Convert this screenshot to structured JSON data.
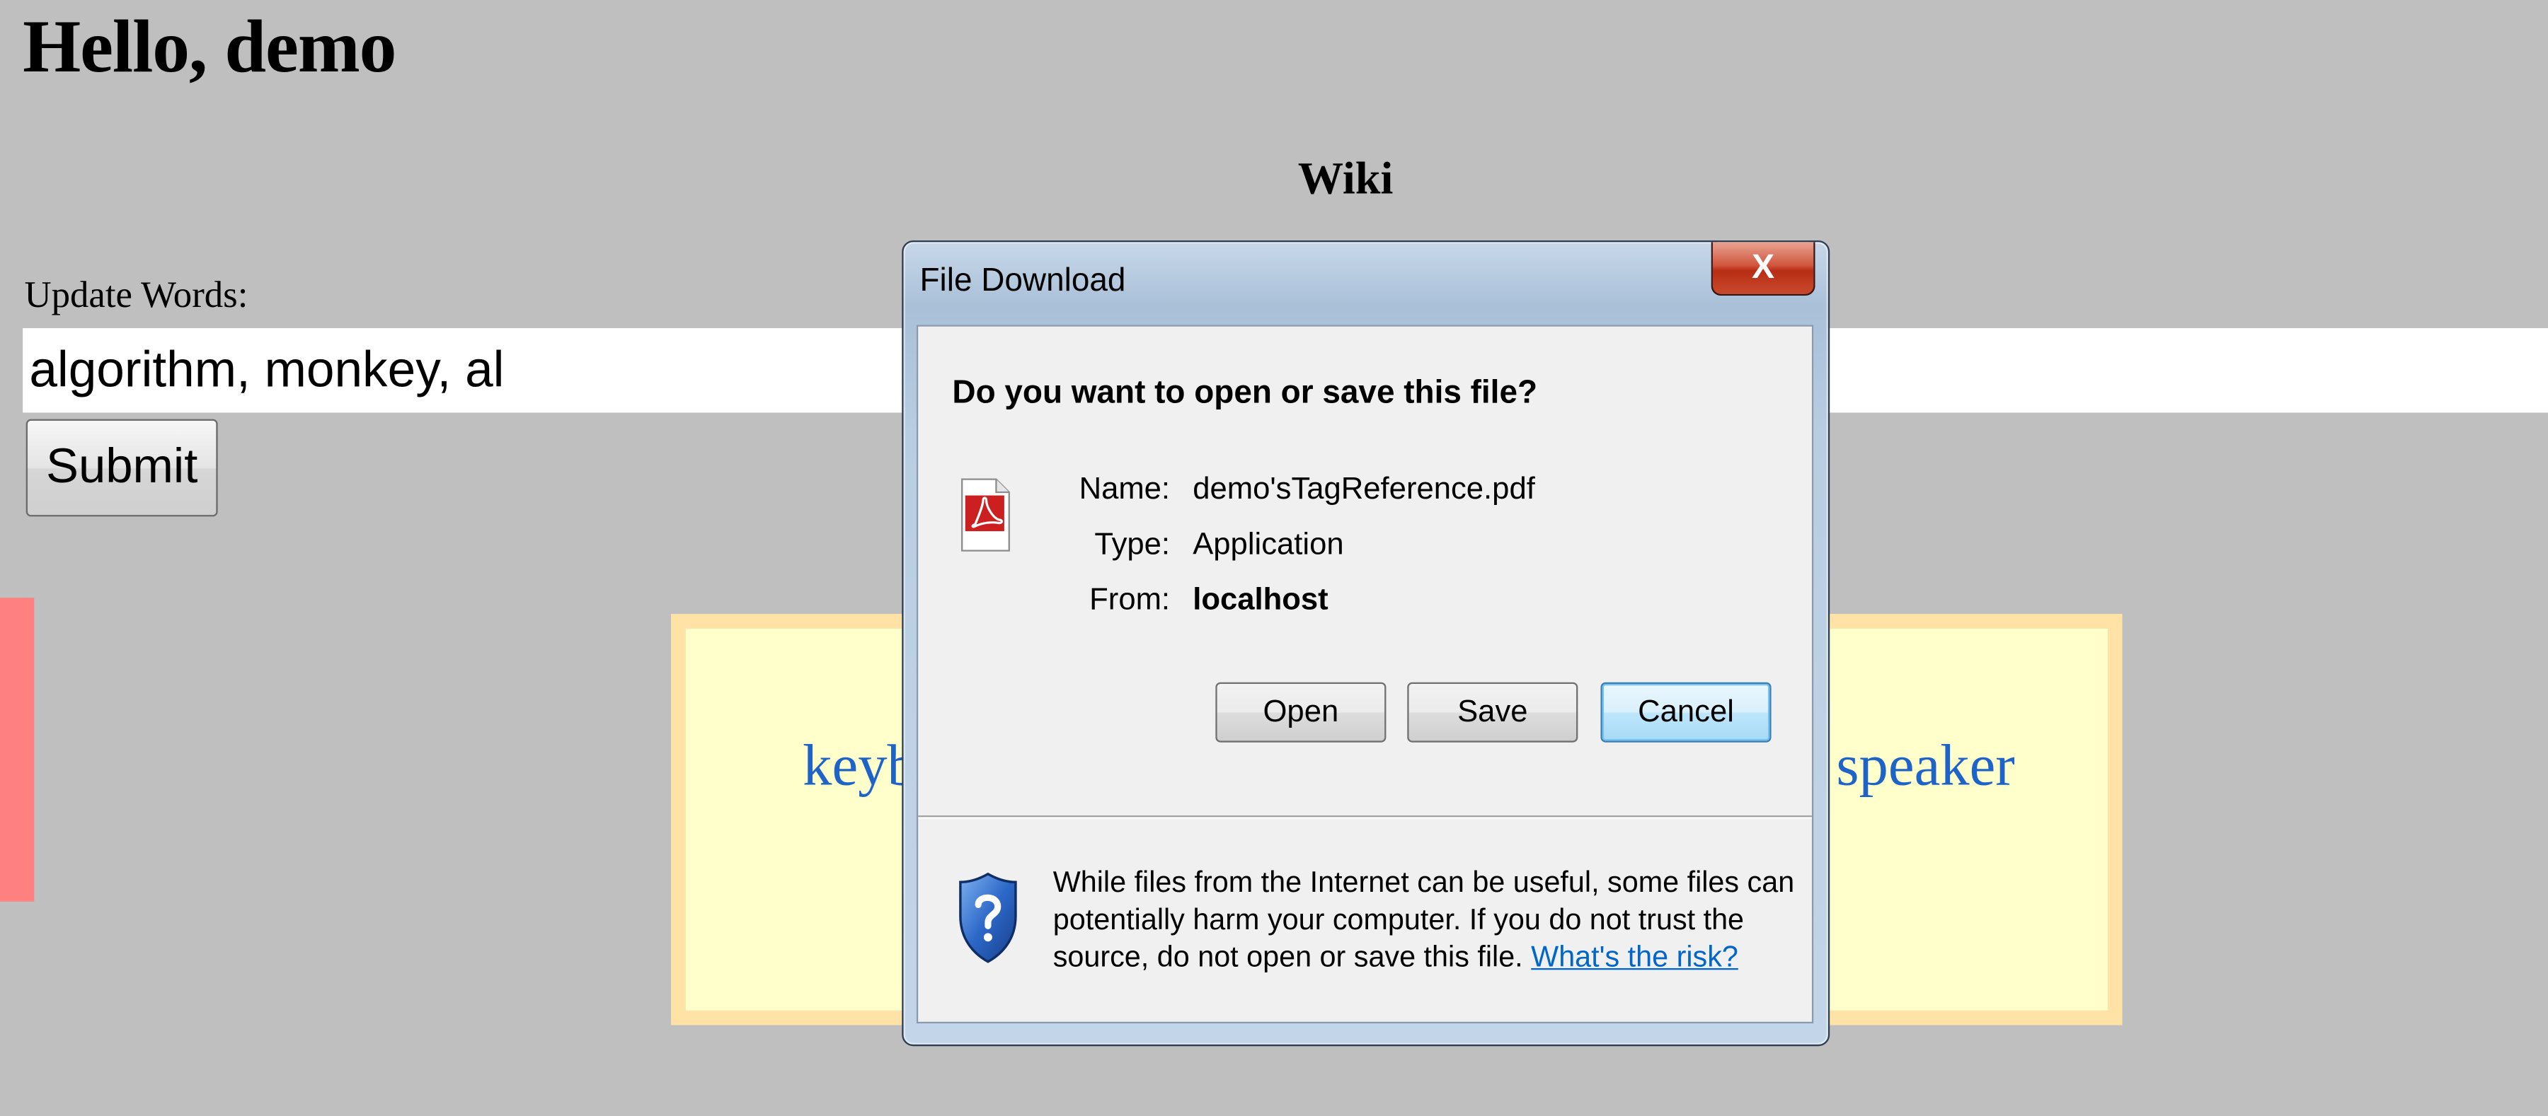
{
  "page": {
    "greeting": "Hello, demo",
    "wiki_title": "Wiki",
    "update_label": "Update Words:",
    "words_value": "algorithm, monkey, al",
    "submit_label": "Submit",
    "tag_cloud": {
      "left_word": "keyb",
      "right_word": "speaker"
    }
  },
  "dialog": {
    "title": "File Download",
    "close_label": "X",
    "question": "Do you want to open or save this file?",
    "fields": {
      "name_label": "Name:",
      "name_value": "demo'sTagReference.pdf",
      "type_label": "Type:",
      "type_value": "Application",
      "from_label": "From:",
      "from_value": "localhost"
    },
    "buttons": {
      "open": "Open",
      "save": "Save",
      "cancel": "Cancel"
    },
    "warning_text": "While files from the Internet can be useful, some files can potentially harm your computer. If you do not trust the source, do not open or save this file.",
    "risk_link": "What's the risk?",
    "icons": {
      "file": "pdf-file-icon",
      "security": "shield-question-icon"
    }
  },
  "colors": {
    "page_background": "#bfbfbf",
    "side_bar": "#ff8080",
    "tag_cloud_border": "#ffe3a6",
    "tag_cloud_fill": "#ffffcc",
    "tag_link": "#1e64c8",
    "link": "#0066cc"
  }
}
